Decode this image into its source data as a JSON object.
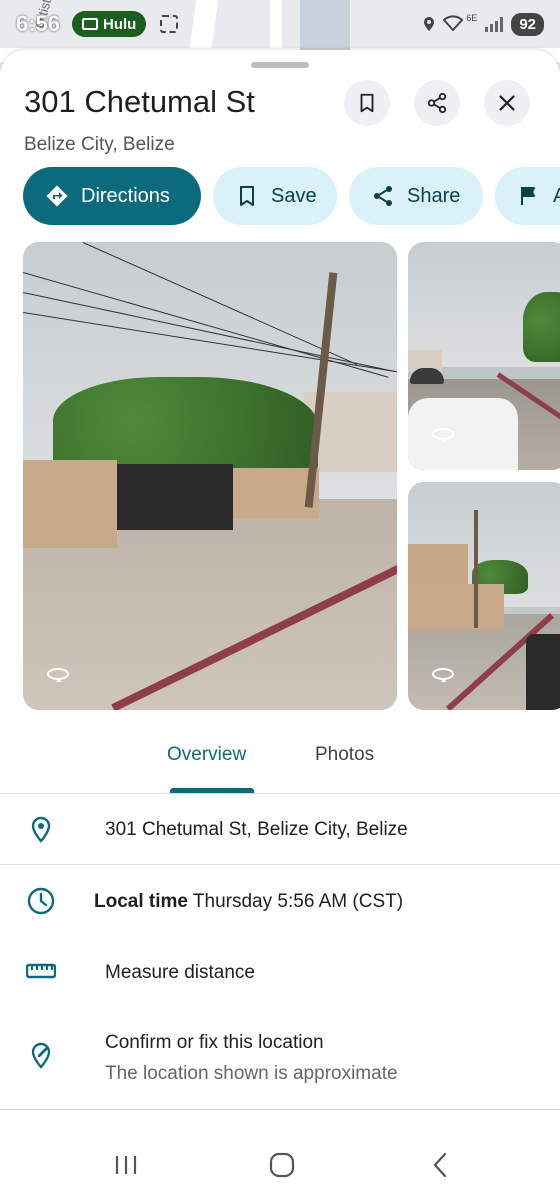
{
  "status_bar": {
    "time": "6:56",
    "notification_app": "Hulu",
    "network": "6E",
    "battery": "92"
  },
  "map": {
    "street_label": "Oltist"
  },
  "place": {
    "title": "301 Chetumal St",
    "subtitle": "Belize City, Belize"
  },
  "header_buttons": {
    "save_icon": "bookmark-icon",
    "share_icon": "share-icon",
    "close_icon": "close-icon"
  },
  "actions": [
    {
      "label": "Directions",
      "icon": "directions-icon"
    },
    {
      "label": "Save",
      "icon": "bookmark-icon"
    },
    {
      "label": "Share",
      "icon": "share-icon"
    },
    {
      "label": "A",
      "icon": "flag-icon"
    }
  ],
  "tabs": [
    {
      "label": "Overview",
      "selected": true
    },
    {
      "label": "Photos",
      "selected": false
    }
  ],
  "info": {
    "address": "301 Chetumal St, Belize City, Belize",
    "local_time_label": "Local time",
    "local_time_value": "Thursday 5:56 AM (CST)",
    "measure": "Measure distance",
    "confirm_title": "Confirm or fix this location",
    "confirm_sub": "The location shown is approximate"
  },
  "colors": {
    "accent": "#0b6b7d",
    "chip_bg": "#d9f1f7",
    "curb": "#8e3e4b"
  }
}
